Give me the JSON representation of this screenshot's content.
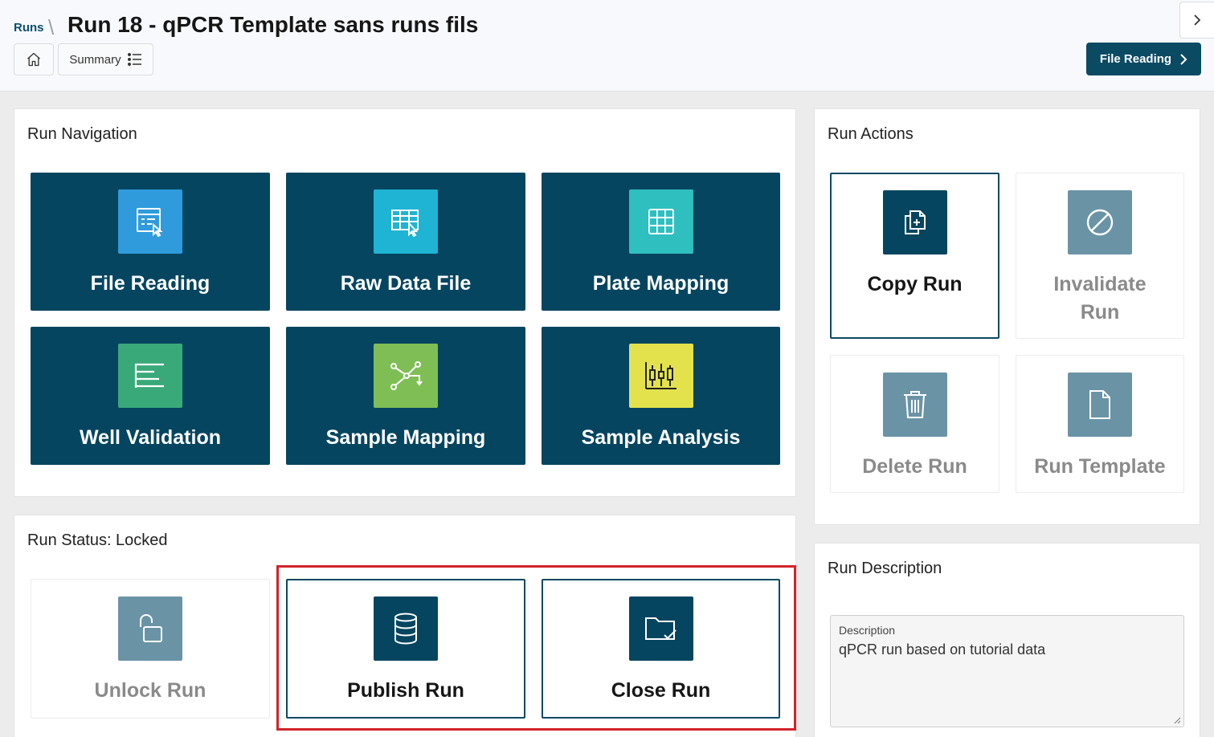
{
  "header": {
    "breadcrumb": "Runs",
    "separator": "\\",
    "title": "Run 18 - qPCR Template sans runs fils",
    "summary_label": "Summary",
    "primary_action": "File Reading"
  },
  "run_navigation": {
    "title": "Run Navigation",
    "tiles": [
      {
        "label": "File Reading",
        "icon": "file-reading-icon",
        "color": "#2f9bdc"
      },
      {
        "label": "Raw Data File",
        "icon": "table-edit-icon",
        "color": "#1fb4d4"
      },
      {
        "label": "Plate Mapping",
        "icon": "grid-icon",
        "color": "#2fbfbf"
      },
      {
        "label": "Well Validation",
        "icon": "list-bars-icon",
        "color": "#3aa97a"
      },
      {
        "label": "Sample Mapping",
        "icon": "workflow-icon",
        "color": "#7fbe55"
      },
      {
        "label": "Sample Analysis",
        "icon": "candlestick-chart-icon",
        "color": "#e3e24c"
      }
    ]
  },
  "run_actions": {
    "title": "Run Actions",
    "tiles": [
      {
        "label": "Copy Run",
        "icon": "copy-icon",
        "enabled": true
      },
      {
        "label": "Invalidate Run",
        "icon": "ban-icon",
        "enabled": false
      },
      {
        "label": "Delete Run",
        "icon": "trash-icon",
        "enabled": false
      },
      {
        "label": "Run Template",
        "icon": "file-icon",
        "enabled": false
      }
    ]
  },
  "run_status": {
    "title": "Run Status: Locked",
    "tiles": [
      {
        "label": "Unlock Run",
        "icon": "unlock-icon",
        "enabled": false
      },
      {
        "label": "Publish Run",
        "icon": "database-icon",
        "enabled": true
      },
      {
        "label": "Close Run",
        "icon": "folder-check-icon",
        "enabled": true
      }
    ]
  },
  "run_description": {
    "title": "Run Description",
    "field_label": "Description",
    "field_value": "qPCR run based on tutorial data"
  },
  "colors": {
    "primary": "#054560",
    "highlight": "#d2232a",
    "disabled_icon": "#6a94a6"
  }
}
